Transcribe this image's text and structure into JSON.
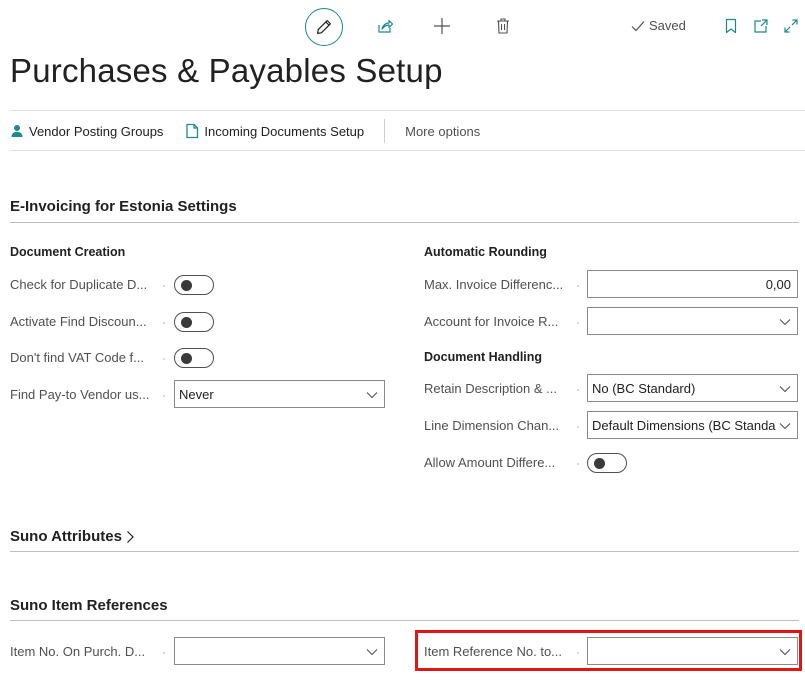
{
  "toolbar": {
    "saved_label": "Saved"
  },
  "page_title": "Purchases & Payables Setup",
  "actions": {
    "vendor_posting_groups": "Vendor Posting Groups",
    "incoming_documents_setup": "Incoming Documents Setup",
    "more_options": "More options"
  },
  "einvoicing": {
    "title": "E-Invoicing for Estonia Settings",
    "document_creation": {
      "title": "Document Creation",
      "check_duplicate": "Check for Duplicate D...",
      "activate_find_discount": "Activate Find Discoun...",
      "dont_find_vat": "Don't find VAT Code f...",
      "find_pay_to_vendor": "Find Pay-to Vendor us...",
      "find_pay_to_vendor_value": "Never"
    },
    "automatic_rounding": {
      "title": "Automatic Rounding",
      "max_invoice_diff": "Max. Invoice Differenc...",
      "max_invoice_diff_value": "0,00",
      "account_invoice_rounding": "Account for Invoice R...",
      "account_invoice_rounding_value": ""
    },
    "document_handling": {
      "title": "Document Handling",
      "retain_description": "Retain Description & ...",
      "retain_description_value": "No (BC Standard)",
      "line_dimension_change": "Line Dimension Chan...",
      "line_dimension_change_value": "Default Dimensions (BC Standa",
      "allow_amount_diff": "Allow Amount Differe..."
    }
  },
  "suno_attributes": {
    "title": "Suno Attributes"
  },
  "suno_item_references": {
    "title": "Suno Item References",
    "item_no_on_purch": "Item No. On Purch. D...",
    "item_no_on_purch_value": "",
    "item_reference_no": "Item Reference No. to...",
    "item_reference_no_value": ""
  },
  "colors": {
    "accent": "#1a8a8a",
    "highlight": "#e01515",
    "text": "#212121",
    "muted": "#505050"
  },
  "icons": [
    "edit-icon",
    "share-icon",
    "plus-icon",
    "trash-icon",
    "checkmark-icon",
    "bookmark-icon",
    "popout-icon",
    "expand-icon",
    "person-icon",
    "document-icon",
    "chevron-down-icon",
    "chevron-right-icon"
  ]
}
